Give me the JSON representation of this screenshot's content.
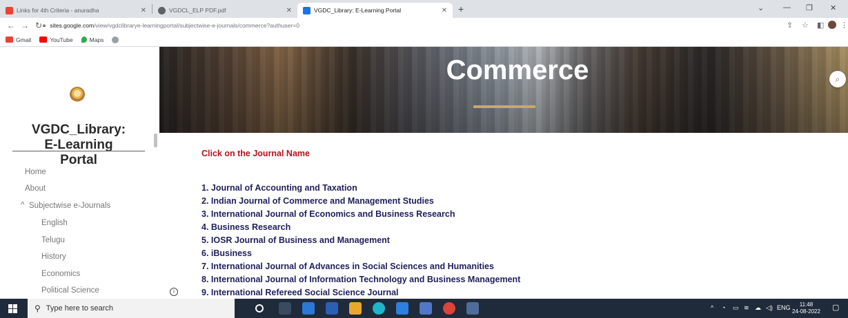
{
  "browser": {
    "tabs": [
      {
        "label": "Links for 4th Criteria - anuradha",
        "favicon_color": "#ea4335"
      },
      {
        "label": "VGDCL_ELP PDF.pdf",
        "favicon_color": "#5f6368"
      },
      {
        "label": "VGDC_Library: E-Learning Portal",
        "favicon_color": "#1a73e8",
        "active": true
      }
    ],
    "url_host": "sites.google.com",
    "url_path": "/view/vgdclibrarye-learningportal/subjectwise-e-journals/commerce?authuser=0",
    "bookmarks": [
      {
        "label": "Gmail",
        "color": "#ea4335"
      },
      {
        "label": "YouTube",
        "color": "#ff0000"
      },
      {
        "label": "Maps",
        "color": "#34a853"
      }
    ]
  },
  "sidebar": {
    "site_title": "VGDC_Library: E-Learning Portal",
    "title_lines": [
      "VGDC_Library:",
      "E-Learning",
      "Portal"
    ],
    "nav": [
      {
        "label": "Home"
      },
      {
        "label": "About"
      },
      {
        "label": "Subjectwise e-Journals",
        "expanded": true
      },
      {
        "label": "English"
      },
      {
        "label": "Telugu"
      },
      {
        "label": "History"
      },
      {
        "label": "Economics"
      },
      {
        "label": "Political Science"
      }
    ]
  },
  "hero": {
    "title": "Commerce",
    "accent": "#c7a96a"
  },
  "content": {
    "instruction": "Click on the Journal Name",
    "instruction_color": "#b5121b",
    "journals": [
      "1. Journal of Accounting and Taxation",
      "2. Indian Journal of Commerce and Management Studies",
      "3. International Journal of Economics and Business Research",
      "4. Business Research",
      "5. IOSR Journal of Business and Management",
      "6. iBusiness",
      "7. International Journal of Advances in Social Sciences and Humanities",
      "8. International Journal of Information Technology and Business Management",
      "9. International Refereed Social Science Journal"
    ]
  },
  "taskbar": {
    "search_placeholder": "Type here to search",
    "language": "ENG",
    "time": "11:48",
    "date": "24-08-2022"
  }
}
